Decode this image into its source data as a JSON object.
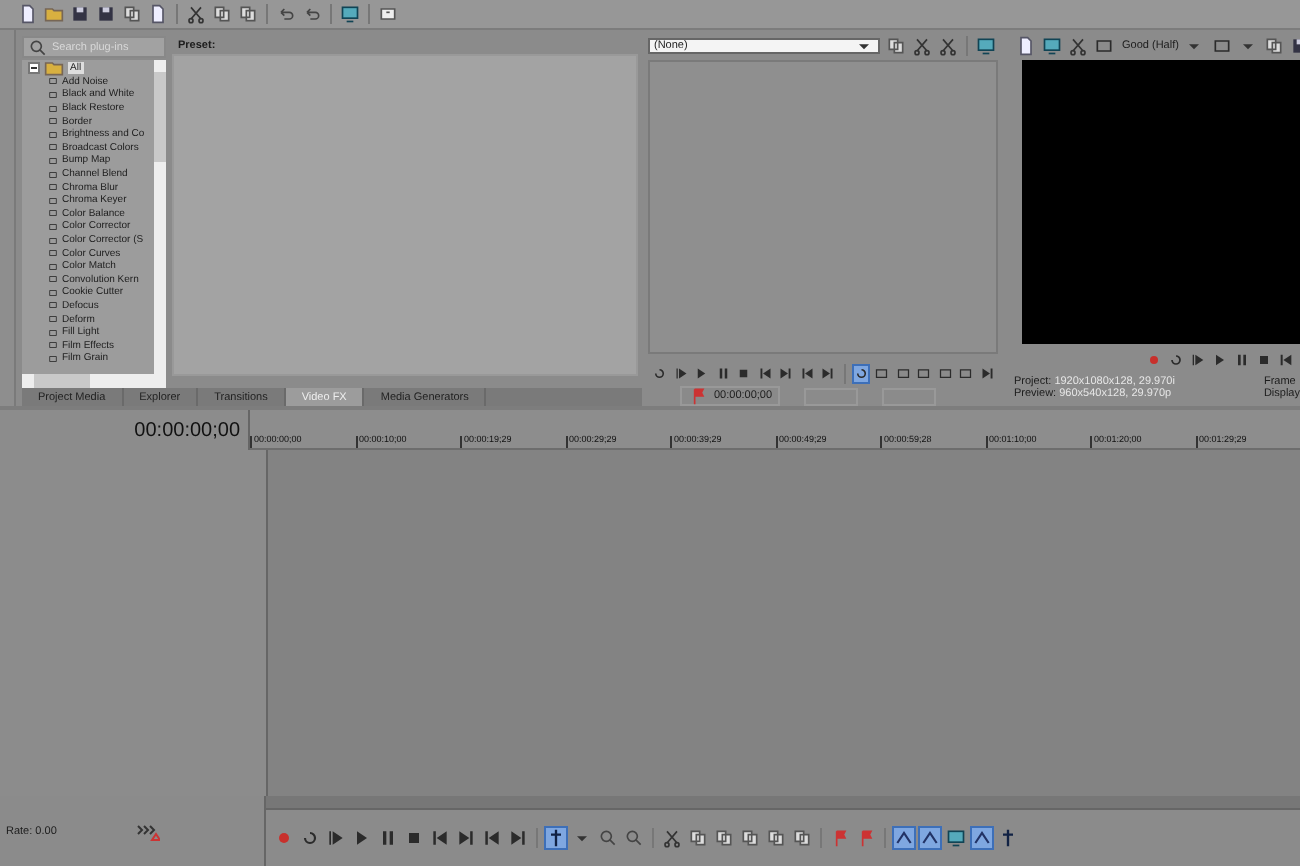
{
  "plugin_browser": {
    "search": {
      "placeholder": "Search plug-ins"
    },
    "tree": [
      {
        "label": "All",
        "expanded": true,
        "children": [
          {
            "label": "Add Noise"
          },
          {
            "label": "Black and White"
          },
          {
            "label": "Black Restore"
          },
          {
            "label": "Border"
          },
          {
            "label": "Brightness and Co"
          },
          {
            "label": "Broadcast Colors"
          },
          {
            "label": "Bump Map"
          },
          {
            "label": "Channel Blend"
          },
          {
            "label": "Chroma Blur"
          },
          {
            "label": "Chroma Keyer"
          },
          {
            "label": "Color Balance"
          },
          {
            "label": "Color Corrector"
          },
          {
            "label": "Color Corrector (S"
          },
          {
            "label": "Color Curves"
          },
          {
            "label": "Color Match"
          },
          {
            "label": "Convolution Kern"
          },
          {
            "label": "Cookie Cutter"
          },
          {
            "label": "Defocus"
          },
          {
            "label": "Deform"
          },
          {
            "label": "Fill Light"
          },
          {
            "label": "Film Effects"
          },
          {
            "label": "Film Grain"
          }
        ]
      }
    ]
  },
  "preset_panel": {
    "title": "Preset:"
  },
  "dock_tabs": [
    {
      "label": "Project Media",
      "selected": false
    },
    {
      "label": "Explorer",
      "selected": false
    },
    {
      "label": "Transitions",
      "selected": false
    },
    {
      "label": "Video FX",
      "selected": true
    },
    {
      "label": "Media Generators",
      "selected": false
    }
  ],
  "trimmer": {
    "dropdown": {
      "value": "(None)"
    },
    "timecode": "00:00:00;00",
    "toolbar": [
      {
        "selected": false
      },
      {
        "selected": false
      },
      {
        "selected": false
      },
      {
        "selected": false
      },
      {
        "selected": false
      },
      {
        "selected": false
      },
      {
        "selected": false
      },
      {
        "selected": false
      },
      {
        "selected": false
      },
      {
        "selected": true
      },
      {
        "selected": false
      },
      {
        "selected": false
      },
      {
        "selected": false
      },
      {
        "selected": false
      },
      {
        "selected": false
      },
      {
        "selected": false
      }
    ]
  },
  "preview": {
    "quality": "Good (Half)",
    "info": [
      {
        "label": "Project:",
        "value": "1920x1080x128, 29.970i"
      },
      {
        "label": "Preview:",
        "value": "960x540x128, 29.970p"
      }
    ],
    "info_right": [
      "Frame",
      "Display"
    ]
  },
  "timeline": {
    "timecode": "00:00:00;00",
    "ruler": [
      "00:00:00;00",
      "00:00:10;00",
      "00:00:19;29",
      "00:00:29;29",
      "00:00:39;29",
      "00:00:49;29",
      "00:00:59;28",
      "00:01:10;00",
      "00:01:20;00",
      "00:01:29;29"
    ],
    "rate": "Rate: 0.00",
    "toolbar": [
      {
        "selected": false
      },
      {
        "selected": false
      },
      {
        "selected": false
      },
      {
        "selected": false
      },
      {
        "selected": false
      },
      {
        "selected": false
      },
      {
        "selected": false
      },
      {
        "selected": false
      },
      {
        "selected": false
      },
      {
        "selected": false
      },
      {
        "selected": true
      },
      {
        "selected": false
      },
      {
        "selected": false
      },
      {
        "selected": false
      },
      {
        "selected": false
      },
      {
        "selected": false
      },
      {
        "selected": false
      },
      {
        "selected": false
      },
      {
        "selected": false
      },
      {
        "selected": false
      },
      {
        "selected": false
      },
      {
        "selected": false
      },
      {
        "selected": true
      },
      {
        "selected": true
      },
      {
        "selected": false
      },
      {
        "selected": true
      },
      {
        "selected": false
      }
    ]
  }
}
